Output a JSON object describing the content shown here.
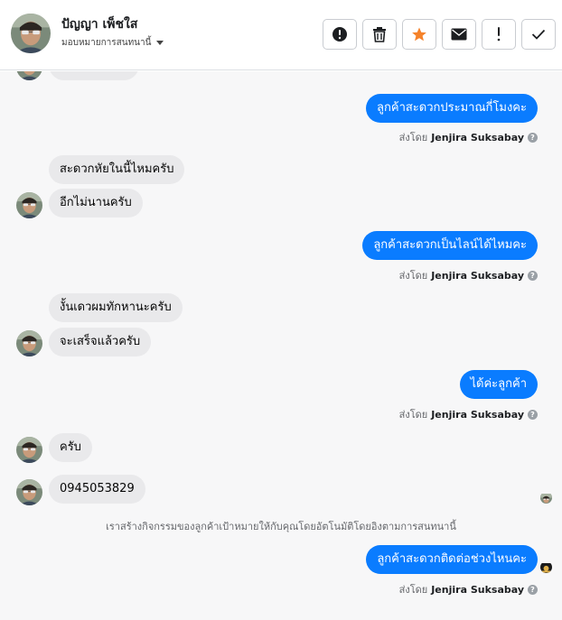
{
  "header": {
    "contact_name": "ปัญญา เพ็ชใส",
    "assign_label": "มอบหมายการสนทนานี้"
  },
  "toolbar": {
    "buttons": [
      {
        "name": "spam-button",
        "icon": "alert-circle-icon"
      },
      {
        "name": "delete-button",
        "icon": "trash-icon"
      },
      {
        "name": "star-button",
        "icon": "star-icon",
        "color": "#f5822a"
      },
      {
        "name": "mark-unread-button",
        "icon": "envelope-icon"
      },
      {
        "name": "follow-up-button",
        "icon": "exclamation-icon"
      },
      {
        "name": "done-button",
        "icon": "check-icon"
      }
    ]
  },
  "sent_by": {
    "prefix": "ส่งโดย",
    "agent": "Jenjira Suksabay"
  },
  "colors": {
    "outgoing": "#0a7cff",
    "incoming": "#e9e9eb"
  },
  "messages": [
    {
      "from": "agent",
      "text": "ลูกค้าสะดวกประมาณกี่โมงคะ"
    },
    {
      "from": "customer",
      "text": "สะดวกหัยในนี้ไหมครับ"
    },
    {
      "from": "customer",
      "text": "อีกไม่นานครับ"
    },
    {
      "from": "agent",
      "text": "ลูกค้าสะดวกเป็นไลน์ได้ไหมคะ"
    },
    {
      "from": "customer",
      "text": "งั้นเดวผมทักหานะครับ"
    },
    {
      "from": "customer",
      "text": "จะเสร็จแล้วครับ"
    },
    {
      "from": "agent",
      "text": "ได้ค่ะลูกค้า"
    },
    {
      "from": "customer",
      "text": "ครับ"
    },
    {
      "from": "customer",
      "text": "0945053829"
    },
    {
      "from": "agent",
      "text": "ลูกค้าสะดวกติดต่อช่วงไหนคะ"
    }
  ],
  "system_note": "เราสร้างกิจกรรมของลูกค้าเป้าหมายให้กับคุณโดยอัตโนมัติโดยอิงตามการสนทนานี้"
}
